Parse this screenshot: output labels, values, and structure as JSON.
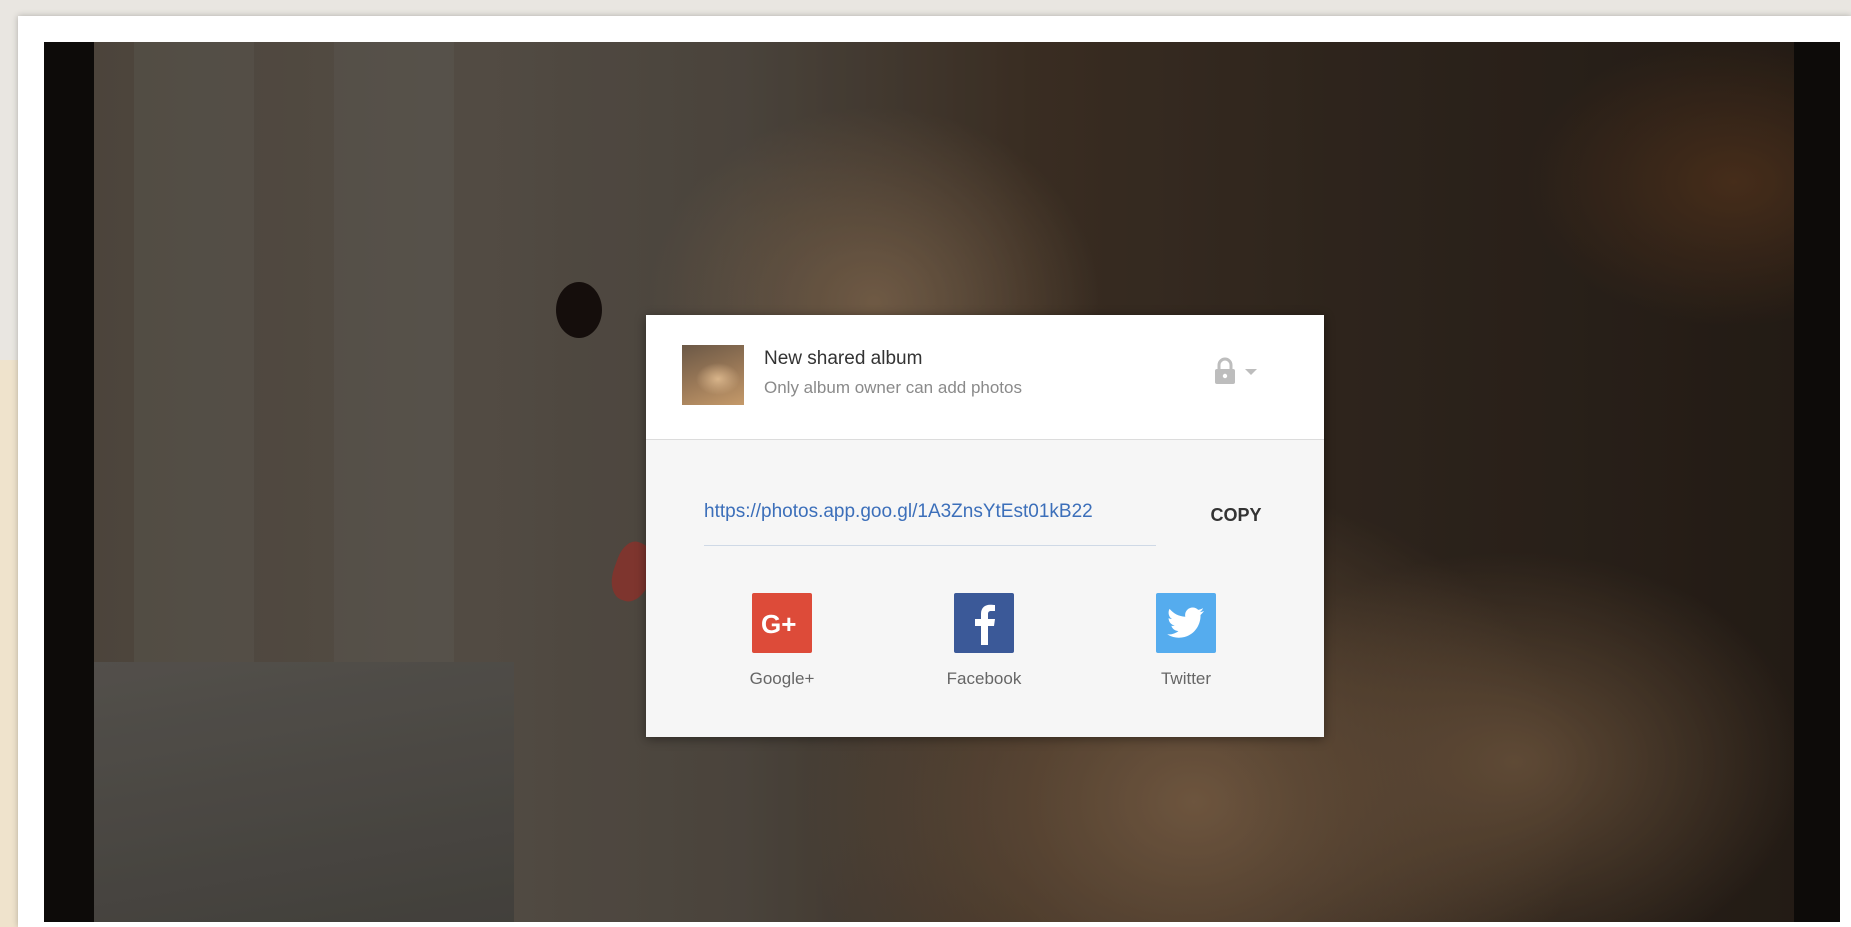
{
  "dialog": {
    "album_title": "New shared album",
    "album_subtitle": "Only album owner can add photos",
    "share_link": "https://photos.app.goo.gl/1A3ZnsYtEst01kB22",
    "copy_label": "COPY",
    "share_options": [
      {
        "label": "Google+",
        "icon": "google-plus-icon",
        "color": "#dd4b39"
      },
      {
        "label": "Facebook",
        "icon": "facebook-icon",
        "color": "#3b5998"
      },
      {
        "label": "Twitter",
        "icon": "twitter-icon",
        "color": "#55acee"
      }
    ]
  },
  "colors": {
    "link": "#3c6fba",
    "google_plus": "#dd4b39",
    "facebook": "#3b5998",
    "twitter": "#55acee"
  }
}
